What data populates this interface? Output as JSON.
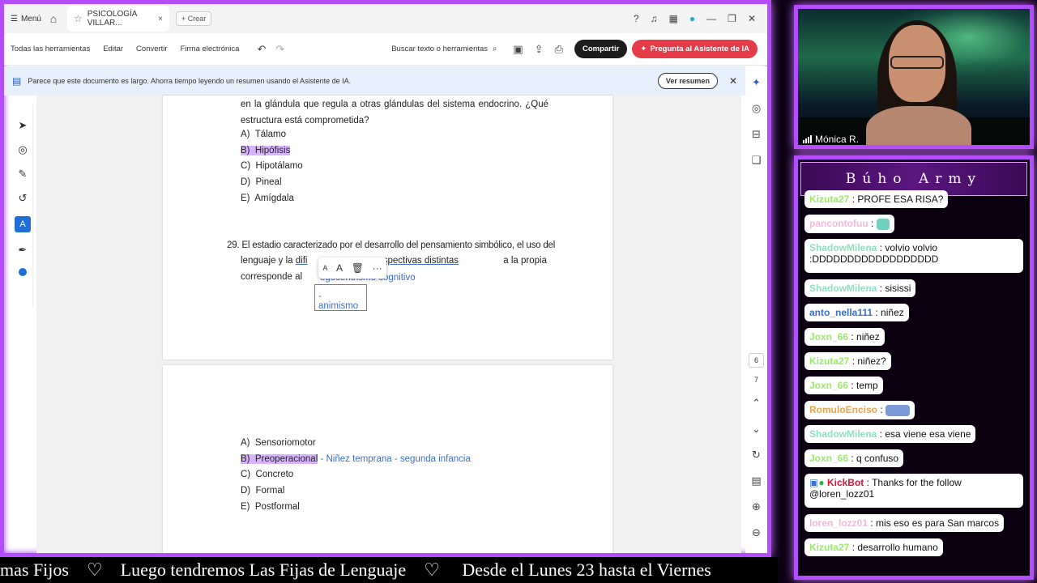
{
  "browser": {
    "menu_label": "Menú",
    "tab_title": "PSICOLOGÍA VILLAR...",
    "new_tab_label": "Crear"
  },
  "toolbar": {
    "all_tools": "Todas las herramientas",
    "edit": "Editar",
    "convert": "Convertir",
    "esign": "Firma electrónica",
    "search_placeholder": "Buscar texto o herramientas",
    "share": "Compartir",
    "ai_assistant": "Pregunta al Asistente de IA"
  },
  "notice": {
    "text": "Parece que este documento es largo. Ahorra tiempo leyendo un resumen usando el Asistente de IA.",
    "button": "Ver resumen"
  },
  "document": {
    "q28_text": "en la glándula que regula a otras glándulas del sistema endocrino. ¿Qué estructura está comprometida?",
    "q28_options": [
      {
        "letter": "A)",
        "text": "Tálamo"
      },
      {
        "letter": "B)",
        "text": "Hipófisis"
      },
      {
        "letter": "C)",
        "text": "Hipotálamo"
      },
      {
        "letter": "D)",
        "text": "Pineal"
      },
      {
        "letter": "E)",
        "text": "Amígdala"
      }
    ],
    "q29_number": "29.",
    "q29_line1": "El estadio caracterizado por el desarrollo del pensamiento simbólico, el uso del",
    "q29_line2_start": "lenguaje y la",
    "q29_line2_mid": "difi",
    "q29_line2_end": "ar perspectivas distintas",
    "q29_line2_tail": "a la propia",
    "q29_line3": "corresponde al",
    "q29_annotation": "egocentrismo cognitivo",
    "textbox_value": "- animismo",
    "q29_options": [
      {
        "letter": "A)",
        "text": "Sensoriomotor"
      },
      {
        "letter": "B)",
        "text": "Preoperacional"
      },
      {
        "letter": "C)",
        "text": "Concreto"
      },
      {
        "letter": "D)",
        "text": "Formal"
      },
      {
        "letter": "E)",
        "text": "Postformal"
      }
    ],
    "q29_note": "- Niñez temprana - segunda infancia"
  },
  "page_nav": {
    "current": "6",
    "next": "7"
  },
  "camera": {
    "name": "Mónica R."
  },
  "chat": {
    "title": "Búho Army",
    "messages": [
      {
        "user": "Kizuta27",
        "text": ": PROFE ESA RISA?",
        "color": "#9be86a"
      },
      {
        "user": "pancontofuu",
        "text": ":",
        "color": "#f2b8d8"
      },
      {
        "user": "ShadowMilena",
        "text": ": volvio volvio",
        "color": "#8fe0c0"
      },
      {
        "user": "",
        "text": ":DDDDDDDDDDDDDDDDDD",
        "color": "#111111"
      },
      {
        "user": "ShadowMilena",
        "text": ": sisissi",
        "color": "#8fe0c0"
      },
      {
        "user": "anto_nella111",
        "text": ": niñez",
        "color": "#3b6fc8"
      },
      {
        "user": "Joxn_66",
        "text": ": niñez",
        "color": "#9be86a"
      },
      {
        "user": "Kizuta27",
        "text": ": niñez?",
        "color": "#9be86a"
      },
      {
        "user": "Joxn_66",
        "text": ": temp",
        "color": "#9be86a"
      },
      {
        "user": "RomuloEnciso",
        "text": ":",
        "color": "#e8a24a"
      },
      {
        "user": "ShadowMilena",
        "text": ": esa viene esa viene",
        "color": "#8fe0c0"
      },
      {
        "user": "Joxn_66",
        "text": ": q confuso",
        "color": "#9be86a"
      },
      {
        "user": "KickBot",
        "text": ": Thanks for the follow",
        "color": "#d2173a"
      },
      {
        "user": "",
        "text": "@loren_lozz01",
        "color": "#111111"
      },
      {
        "user": "loren_lozz01",
        "text": ": mis eso es para San marcos",
        "color": "#f2b8d8"
      },
      {
        "user": "Kizuta27",
        "text": ": desarrollo humano",
        "color": "#9be86a"
      }
    ]
  },
  "ticker": {
    "text": "mas Fijos    ♡    Luego tendremos Las Fijas de Lenguaje    ♡     Desde el Lunes 23 hasta el Viernes"
  },
  "colors": {
    "accent": "#b44dff",
    "highlight": "#d9b3ff",
    "annotation": "#3b6fc8"
  }
}
